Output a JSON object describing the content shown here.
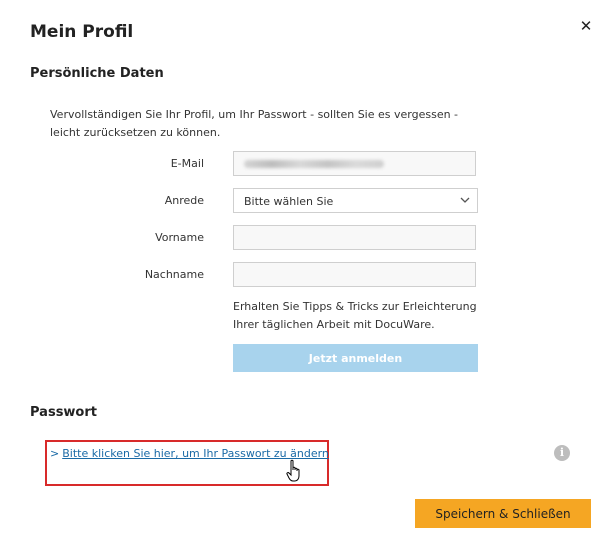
{
  "dialog": {
    "title": "Mein Profil",
    "close_icon": "close-icon"
  },
  "personal": {
    "heading": "Persönliche Daten",
    "intro": "Vervollständigen Sie Ihr Profil, um Ihr Passwort - sollten Sie es vergessen - leicht zurücksetzen zu können.",
    "email_label": "E-Mail",
    "email_value": "",
    "salutation_label": "Anrede",
    "salutation_value": "Bitte wählen Sie",
    "firstname_label": "Vorname",
    "firstname_value": "",
    "lastname_label": "Nachname",
    "lastname_value": "",
    "tips_text": "Erhalten Sie Tipps & Tricks zur Erleichterung Ihrer täglichen Arbeit mit DocuWare.",
    "register_button": "Jetzt anmelden"
  },
  "password": {
    "heading": "Passwort",
    "link_arrow": ">",
    "link_text": "Bitte klicken Sie hier, um Ihr Passwort zu ändern",
    "info_icon": "info-icon"
  },
  "footer": {
    "save_button": "Speichern & Schließen"
  },
  "colors": {
    "accent": "#f5a623",
    "register_button": "#a8d3ed",
    "link": "#1a6aa6",
    "highlight": "#d82a2a"
  }
}
